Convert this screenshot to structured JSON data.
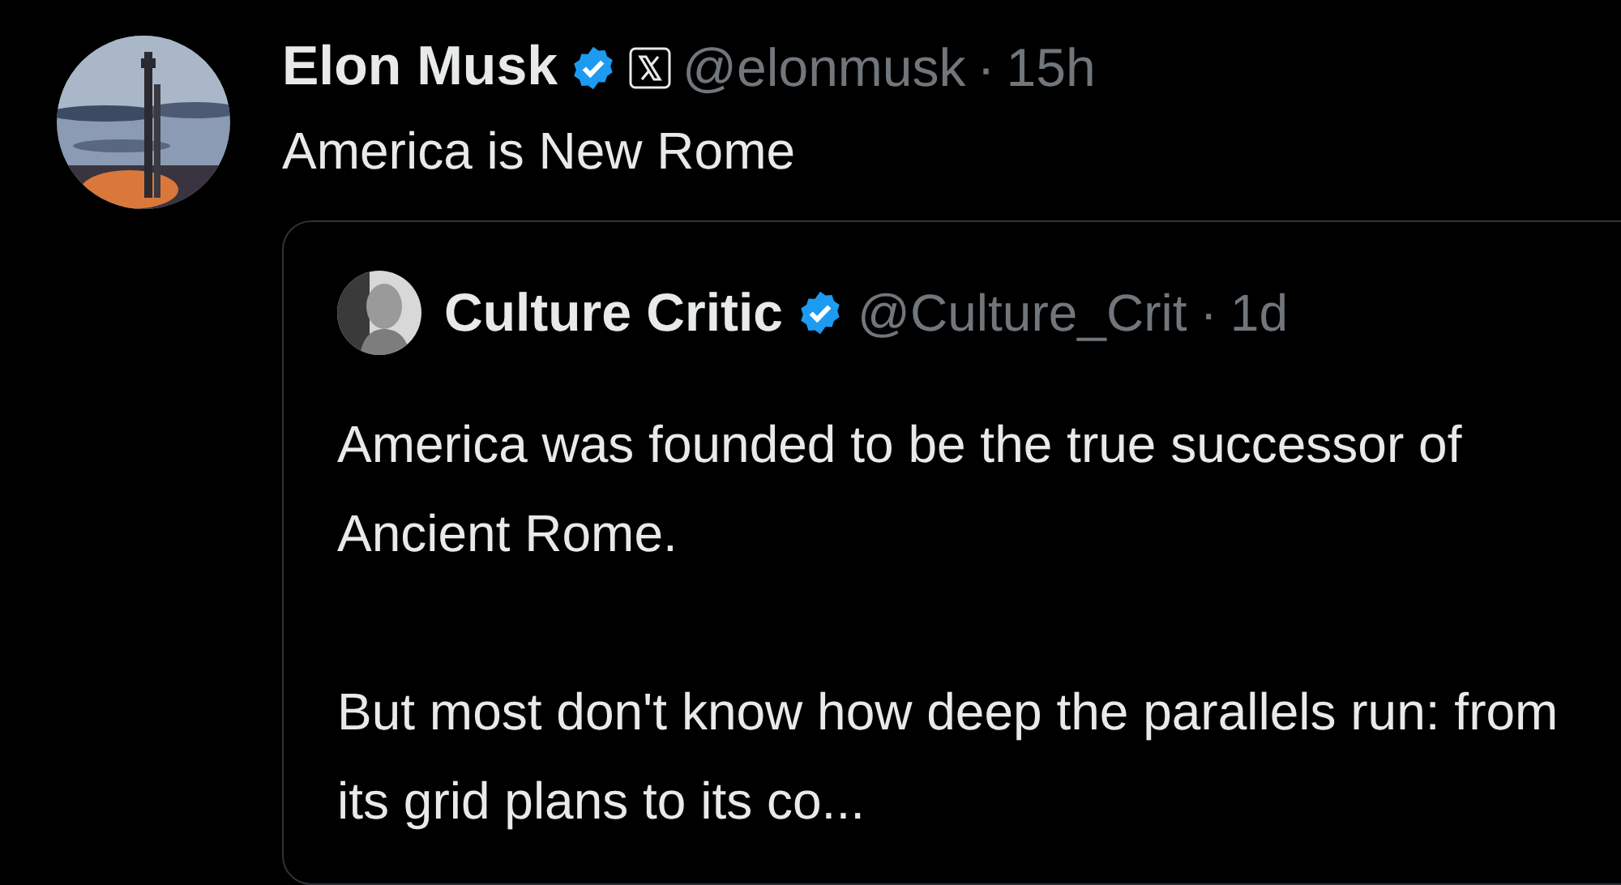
{
  "tweet": {
    "author": {
      "name": "Elon Musk",
      "verified": true,
      "affiliate_badge": true,
      "handle": "@elonmusk",
      "separator": "·",
      "time": "15h"
    },
    "text": "America is New Rome",
    "quote": {
      "author": {
        "name": "Culture Critic",
        "verified": true,
        "handle": "@Culture_Crit",
        "separator": "·",
        "time": "1d"
      },
      "paragraphs": [
        "America was founded to be the true successor of Ancient Rome.",
        "But most don't know how deep the parallels run: from its grid plans to its co..."
      ]
    }
  }
}
